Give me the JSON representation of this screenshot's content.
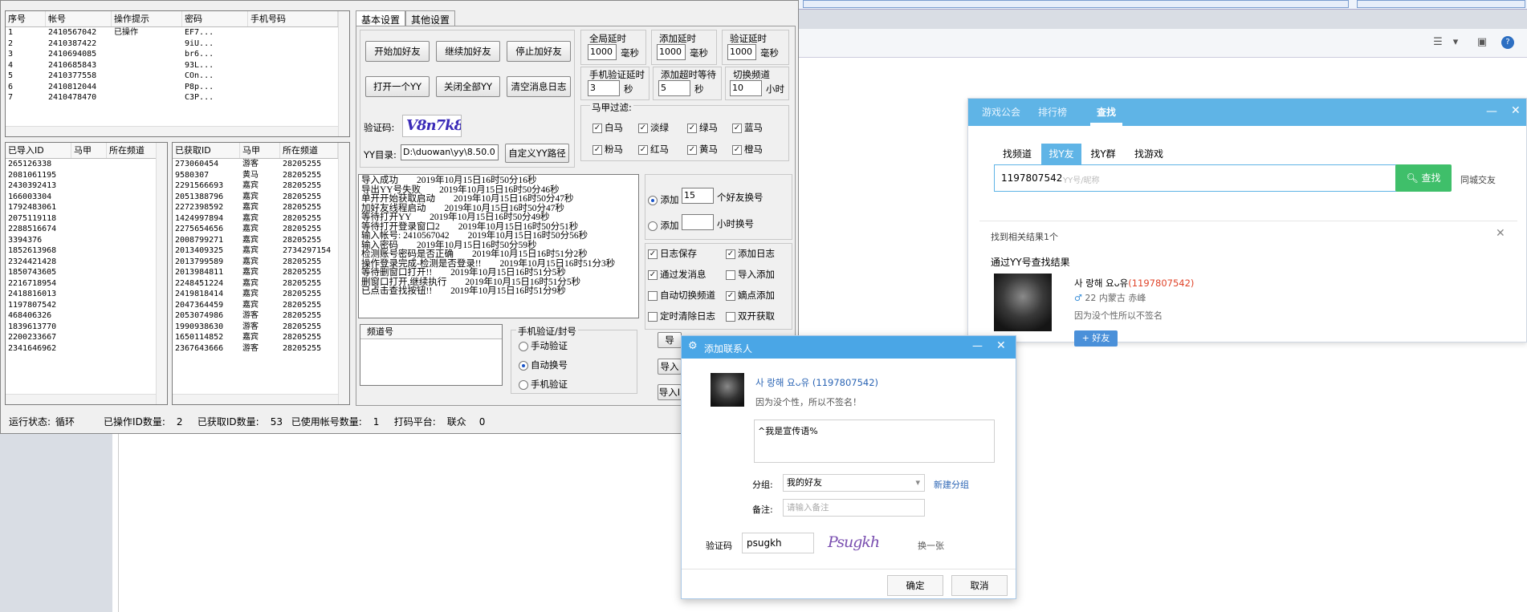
{
  "colors": {
    "accent_blue": "#5fb4e6",
    "search_green": "#3fbf6a",
    "yy_red": "#e0442a",
    "dialog_blue": "#4aa6e6"
  },
  "tool": {
    "account_table": {
      "headers": [
        "序号",
        "帐号",
        "操作提示",
        "密码",
        "手机号码"
      ],
      "rows": [
        [
          "1",
          "2410567042",
          "已操作",
          "EF7...",
          ""
        ],
        [
          "2",
          "2410387422",
          "",
          "9iU...",
          ""
        ],
        [
          "3",
          "2410694085",
          "",
          "br6...",
          ""
        ],
        [
          "4",
          "2410685843",
          "",
          "93L...",
          ""
        ],
        [
          "5",
          "2410377558",
          "",
          "COn...",
          ""
        ],
        [
          "6",
          "2410812044",
          "",
          "P8p...",
          ""
        ],
        [
          "7",
          "2410478470",
          "",
          "C3P...",
          ""
        ]
      ]
    },
    "imported_table": {
      "headers": [
        "已导入ID",
        "马甲",
        "所在频道"
      ],
      "rows": [
        "265126338",
        "2081061195",
        "2430392413",
        "166003304",
        "1792483061",
        "2075119118",
        "2288516674",
        "3394376",
        "1852613968",
        "2324421428",
        "1850743605",
        "2216718954",
        "2418816013",
        "1197807542",
        "468406326",
        "1839613770",
        "2200233667",
        "2341646962"
      ]
    },
    "fetched_table": {
      "headers": [
        "已获取ID",
        "马甲",
        "所在频道"
      ],
      "rows": [
        [
          "273060454",
          "游客",
          "28205255"
        ],
        [
          "9580307",
          "黄马",
          "28205255"
        ],
        [
          "2291566693",
          "嘉宾",
          "28205255"
        ],
        [
          "2051388796",
          "嘉宾",
          "28205255"
        ],
        [
          "2272398592",
          "嘉宾",
          "28205255"
        ],
        [
          "1424997894",
          "嘉宾",
          "28205255"
        ],
        [
          "2275654656",
          "嘉宾",
          "28205255"
        ],
        [
          "2008799271",
          "嘉宾",
          "28205255"
        ],
        [
          "2013409325",
          "嘉宾",
          "2734297154"
        ],
        [
          "2013799589",
          "嘉宾",
          "28205255"
        ],
        [
          "2013984811",
          "嘉宾",
          "28205255"
        ],
        [
          "2248451224",
          "嘉宾",
          "28205255"
        ],
        [
          "2419818414",
          "嘉宾",
          "28205255"
        ],
        [
          "2047364459",
          "嘉宾",
          "28205255"
        ],
        [
          "2053074986",
          "游客",
          "28205255"
        ],
        [
          "1990938630",
          "游客",
          "28205255"
        ],
        [
          "1650114852",
          "嘉宾",
          "28205255"
        ],
        [
          "2367643666",
          "游客",
          "28205255"
        ]
      ]
    },
    "tabs": [
      "基本设置",
      "其他设置"
    ],
    "buttons": {
      "start": "开始加好友",
      "continue": "继续加好友",
      "stop": "停止加好友",
      "open_one": "打开一个YY",
      "close_all": "关闭全部YY",
      "clear_log": "清空消息日志",
      "custom_path": "自定义YY路径",
      "import1": "导",
      "import2": "导入",
      "import3": "导入I"
    },
    "captcha_label": "验证码:",
    "captcha_text": "V8n7k8",
    "yy_dir_label": "YY目录:",
    "yy_dir_value": "D:\\duowan\\yy\\8.50.0",
    "delays": {
      "global_label": "全局延时",
      "global_value": "1000",
      "global_unit": "毫秒",
      "add_label": "添加延时",
      "add_value": "1000",
      "add_unit": "毫秒",
      "verify_label": "验证延时",
      "verify_value": "1000",
      "verify_unit": "毫秒",
      "phone_label": "手机验证延时",
      "phone_value": "3",
      "phone_unit": "秒",
      "timeout_label": "添加超时等待",
      "timeout_value": "5",
      "timeout_unit": "秒",
      "switch_label": "切换频道",
      "switch_value": "10",
      "switch_unit": "小时"
    },
    "filter_label": "马甲过滤:",
    "filters": [
      "白马",
      "淡绿",
      "绿马",
      "蓝马",
      "粉马",
      "红马",
      "黄马",
      "橙马"
    ],
    "log_lines": [
      "导入成功        2019年10月15日16时50分16秒",
      "导出YY号失败        2019年10月15日16时50分46秒",
      "单开开始获取启动        2019年10月15日16时50分47秒",
      "加好友线程启动        2019年10月15日16时50分47秒",
      "等待打开YY        2019年10月15日16时50分49秒",
      "等待打开登录窗口2        2019年10月15日16时50分51秒",
      "输入帐号: 2410567042        2019年10月15日16时50分56秒",
      "输入密码        2019年10月15日16时50分59秒",
      "检测账号密码是否正确        2019年10月15日16时51分2秒",
      "操作登录完成-检测是否登录!!        2019年10月15日16时51分3秒",
      "等待删窗口打开!!        2019年10月15日16时51分5秒",
      "删窗口打开,继续执行        2019年10月15日16时51分5秒",
      "已点击查找按钮!!        2019年10月15日16时51分9秒"
    ],
    "add_option1_label": "添加",
    "add_option1_value": "15",
    "add_option1_suffix": "个好友换号",
    "add_option2_label": "添加",
    "add_option2_suffix": "小时换号",
    "checkboxes": [
      {
        "label": "日志保存",
        "checked": true
      },
      {
        "label": "添加日志",
        "checked": true
      },
      {
        "label": "通过发消息",
        "checked": true
      },
      {
        "label": "导入添加",
        "checked": false
      },
      {
        "label": "自动切换频道",
        "checked": false
      },
      {
        "label": "嫡点添加",
        "checked": true
      },
      {
        "label": "定时清除日志",
        "checked": false
      },
      {
        "label": "双开获取",
        "checked": false
      }
    ],
    "channel_header": "频道号",
    "phone_group_label": "手机验证/封号",
    "phone_radios": [
      {
        "label": "手动验证",
        "on": false
      },
      {
        "label": "自动换号",
        "on": true
      },
      {
        "label": "手机验证",
        "on": false
      }
    ],
    "status": {
      "run_label": "运行状态:",
      "run_value": "循环",
      "ops_label": "已操作ID数量:",
      "ops_value": "2",
      "got_label": "已获取ID数量:",
      "got_value": "53",
      "used_label": "已使用帐号数量:",
      "used_value": "1",
      "captcha_label": "打码平台:",
      "captcha_value": "联众",
      "captcha_count": "0"
    }
  },
  "yy_panel": {
    "nav": [
      "游戏公会",
      "排行榜",
      "查找"
    ],
    "subtabs": [
      "找频道",
      "找Y友",
      "找Y群",
      "找游戏"
    ],
    "search_value": "1197807542",
    "search_placeholder": "YY号/昵称",
    "search_button": "查找",
    "same_city": "同城交友",
    "result_count": "找到相关结果1个",
    "result_section": "通过YY号查找结果",
    "result_name": "사 랑해 요ᴗ유",
    "result_id": "(1197807542)",
    "result_meta": "22 内蒙古 赤峰",
    "result_sign": "因为没个性所以不签名",
    "add_friend": "好友"
  },
  "dialog": {
    "title": "添加联系人",
    "name": "사 랑해 요ᴗ유",
    "id": "(1197807542)",
    "sign": "因为没个性，所以不签名！",
    "message": "^我是宣传语%",
    "group_label": "分组:",
    "group_value": "我的好友",
    "new_group": "新建分组",
    "remark_label": "备注:",
    "remark_placeholder": "请输入备注",
    "captcha_label": "验证码",
    "captcha_value": "psugkh",
    "captcha_image_text": "Psugkh",
    "refresh": "换一张",
    "ok": "确定",
    "cancel": "取消"
  }
}
